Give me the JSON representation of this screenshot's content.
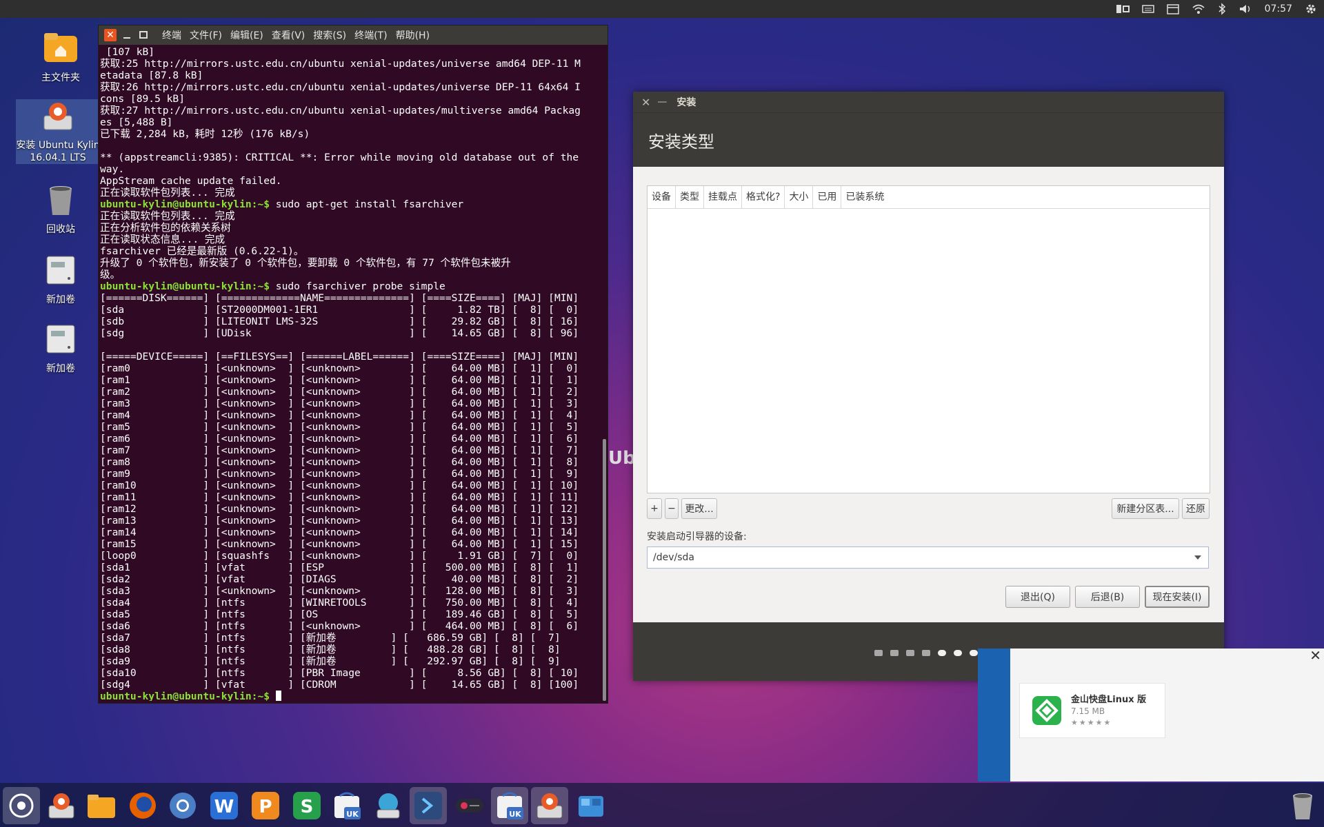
{
  "top_panel": {
    "clock": "07:57",
    "icons": [
      "ubuntu-kylin-indicator-icon",
      "keyboard-icon",
      "calendar-icon",
      "wifi-icon",
      "bluetooth-icon",
      "volume-icon",
      "settings-gear-icon"
    ]
  },
  "desktop": {
    "icons": [
      {
        "name": "home-folder",
        "label": "主文件夹"
      },
      {
        "name": "install-ubuntu-kylin",
        "label": "安装 Ubuntu Kylin 16.04.1 LTS"
      },
      {
        "name": "trash",
        "label": "回收站"
      },
      {
        "name": "new-volume-1",
        "label": "新加卷"
      },
      {
        "name": "new-volume-2",
        "label": "新加卷"
      }
    ]
  },
  "terminal": {
    "menu": [
      "终端",
      "文件(F)",
      "编辑(E)",
      "查看(V)",
      "搜索(S)",
      "终端(T)",
      "帮助(H)"
    ],
    "lines": [
      {
        "t": " [107 kB]"
      },
      {
        "t": "获取:25 http://mirrors.ustc.edu.cn/ubuntu xenial-updates/universe amd64 DEP-11 M"
      },
      {
        "t": "etadata [87.8 kB]"
      },
      {
        "t": "获取:26 http://mirrors.ustc.edu.cn/ubuntu xenial-updates/universe DEP-11 64x64 I"
      },
      {
        "t": "cons [89.5 kB]"
      },
      {
        "t": "获取:27 http://mirrors.ustc.edu.cn/ubuntu xenial-updates/multiverse amd64 Packag"
      },
      {
        "t": "es [5,488 B]"
      },
      {
        "t": "已下载 2,284 kB，耗时 12秒 (176 kB/s)"
      },
      {
        "t": ""
      },
      {
        "t": "** (appstreamcli:9385): CRITICAL **: Error while moving old database out of the"
      },
      {
        "t": "way."
      },
      {
        "t": "AppStream cache update failed."
      },
      {
        "t": "正在读取软件包列表... 完成"
      },
      {
        "p": "ubuntu-kylin@ubuntu-kylin:~$",
        "t": " sudo apt-get install fsarchiver"
      },
      {
        "t": "正在读取软件包列表... 完成"
      },
      {
        "t": "正在分析软件包的依赖关系树"
      },
      {
        "t": "正在读取状态信息... 完成"
      },
      {
        "t": "fsarchiver 已经是最新版 (0.6.22-1)。"
      },
      {
        "t": "升级了 0 个软件包，新安装了 0 个软件包，要卸载 0 个软件包，有 77 个软件包未被升"
      },
      {
        "t": "级。"
      },
      {
        "p": "ubuntu-kylin@ubuntu-kylin:~$",
        "t": " sudo fsarchiver probe simple"
      },
      {
        "t": "[======DISK======] [=============NAME==============] [====SIZE====] [MAJ] [MIN]"
      },
      {
        "t": "[sda             ] [ST2000DM001-1ER1               ] [     1.82 TB] [  8] [  0]"
      },
      {
        "t": "[sdb             ] [LITEONIT LMS-32S               ] [    29.82 GB] [  8] [ 16]"
      },
      {
        "t": "[sdg             ] [UDisk                          ] [    14.65 GB] [  8] [ 96]"
      },
      {
        "t": ""
      },
      {
        "t": "[=====DEVICE=====] [==FILESYS==] [======LABEL======] [====SIZE====] [MAJ] [MIN]"
      },
      {
        "t": "[ram0            ] [<unknown>  ] [<unknown>        ] [    64.00 MB] [  1] [  0]"
      },
      {
        "t": "[ram1            ] [<unknown>  ] [<unknown>        ] [    64.00 MB] [  1] [  1]"
      },
      {
        "t": "[ram2            ] [<unknown>  ] [<unknown>        ] [    64.00 MB] [  1] [  2]"
      },
      {
        "t": "[ram3            ] [<unknown>  ] [<unknown>        ] [    64.00 MB] [  1] [  3]"
      },
      {
        "t": "[ram4            ] [<unknown>  ] [<unknown>        ] [    64.00 MB] [  1] [  4]"
      },
      {
        "t": "[ram5            ] [<unknown>  ] [<unknown>        ] [    64.00 MB] [  1] [  5]"
      },
      {
        "t": "[ram6            ] [<unknown>  ] [<unknown>        ] [    64.00 MB] [  1] [  6]"
      },
      {
        "t": "[ram7            ] [<unknown>  ] [<unknown>        ] [    64.00 MB] [  1] [  7]"
      },
      {
        "t": "[ram8            ] [<unknown>  ] [<unknown>        ] [    64.00 MB] [  1] [  8]"
      },
      {
        "t": "[ram9            ] [<unknown>  ] [<unknown>        ] [    64.00 MB] [  1] [  9]"
      },
      {
        "t": "[ram10           ] [<unknown>  ] [<unknown>        ] [    64.00 MB] [  1] [ 10]"
      },
      {
        "t": "[ram11           ] [<unknown>  ] [<unknown>        ] [    64.00 MB] [  1] [ 11]"
      },
      {
        "t": "[ram12           ] [<unknown>  ] [<unknown>        ] [    64.00 MB] [  1] [ 12]"
      },
      {
        "t": "[ram13           ] [<unknown>  ] [<unknown>        ] [    64.00 MB] [  1] [ 13]"
      },
      {
        "t": "[ram14           ] [<unknown>  ] [<unknown>        ] [    64.00 MB] [  1] [ 14]"
      },
      {
        "t": "[ram15           ] [<unknown>  ] [<unknown>        ] [    64.00 MB] [  1] [ 15]"
      },
      {
        "t": "[loop0           ] [squashfs   ] [<unknown>        ] [     1.91 GB] [  7] [  0]"
      },
      {
        "t": "[sda1            ] [vfat       ] [ESP              ] [   500.00 MB] [  8] [  1]"
      },
      {
        "t": "[sda2            ] [vfat       ] [DIAGS            ] [    40.00 MB] [  8] [  2]"
      },
      {
        "t": "[sda3            ] [<unknown>  ] [<unknown>        ] [   128.00 MB] [  8] [  3]"
      },
      {
        "t": "[sda4            ] [ntfs       ] [WINRETOOLS       ] [   750.00 MB] [  8] [  4]"
      },
      {
        "t": "[sda5            ] [ntfs       ] [OS               ] [   189.46 GB] [  8] [  5]"
      },
      {
        "t": "[sda6            ] [ntfs       ] [<unknown>        ] [   464.00 MB] [  8] [  6]"
      },
      {
        "t": "[sda7            ] [ntfs       ] [新加卷         ] [   686.59 GB] [  8] [  7]"
      },
      {
        "t": "[sda8            ] [ntfs       ] [新加卷         ] [   488.28 GB] [  8] [  8]"
      },
      {
        "t": "[sda9            ] [ntfs       ] [新加卷         ] [   292.97 GB] [  8] [  9]"
      },
      {
        "t": "[sda10           ] [ntfs       ] [PBR Image        ] [     8.56 GB] [  8] [ 10]"
      },
      {
        "t": "[sdg4            ] [vfat       ] [CDROM            ] [    14.65 GB] [  8] [100]"
      },
      {
        "p": "ubuntu-kylin@ubuntu-kylin:~$",
        "t": " ",
        "cursor": true
      }
    ]
  },
  "installer": {
    "title": "安装",
    "header": "安装类型",
    "columns": [
      "设备",
      "类型",
      "挂载点",
      "格式化?",
      "大小",
      "已用",
      "已装系统"
    ],
    "add_label": "+",
    "remove_label": "−",
    "change_label": "更改...",
    "new_table_label": "新建分区表...",
    "revert_label": "还原",
    "bootloader_label": "安装启动引导器的设备:",
    "bootloader_value": "/dev/sda",
    "quit_label": "退出(Q)",
    "back_label": "后退(B)",
    "install_label": "现在安装(I)",
    "progress_steps": 7,
    "current_step": 5
  },
  "notification": {
    "app_name": "金山快盘Linux 版",
    "size": "7.15 MB",
    "rating_stars": 4,
    "close_label": "✕"
  },
  "background_text": "Ubu",
  "dock": {
    "items": [
      "ubuntu-kylin-start-icon",
      "installer-icon",
      "files-icon",
      "firefox-icon",
      "chromium-icon",
      "wps-writer-icon",
      "wps-presentation-icon",
      "wps-spreadsheet-icon",
      "ubuntu-kylin-software-center-icon",
      "disk-utility-icon",
      "terminal-icon",
      "recorder-icon",
      "ubuntu-kylin-software-center-2-icon",
      "installer-2-icon",
      "workspace-switcher-icon"
    ],
    "trash": "trash-icon"
  }
}
